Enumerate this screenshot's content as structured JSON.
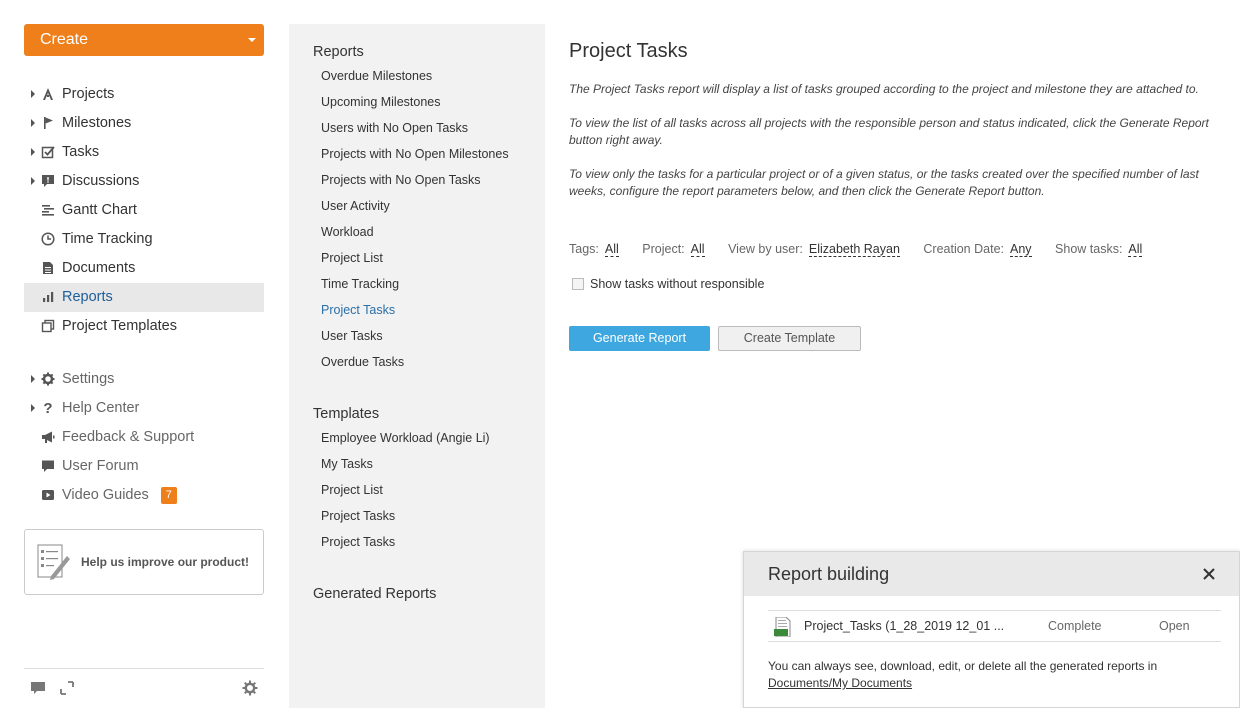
{
  "sidebar": {
    "create_label": "Create",
    "items": [
      {
        "label": "Projects",
        "icon": "projects-icon",
        "expandable": true
      },
      {
        "label": "Milestones",
        "icon": "flag-icon",
        "expandable": true
      },
      {
        "label": "Tasks",
        "icon": "checkbox-icon",
        "expandable": true
      },
      {
        "label": "Discussions",
        "icon": "discussion-icon",
        "expandable": true
      },
      {
        "label": "Gantt Chart",
        "icon": "gantt-icon",
        "expandable": false
      },
      {
        "label": "Time Tracking",
        "icon": "clock-icon",
        "expandable": false
      },
      {
        "label": "Documents",
        "icon": "document-icon",
        "expandable": false
      },
      {
        "label": "Reports",
        "icon": "bar-chart-icon",
        "expandable": false,
        "active": true
      },
      {
        "label": "Project Templates",
        "icon": "templates-icon",
        "expandable": false
      }
    ],
    "secondary_items": [
      {
        "label": "Settings",
        "icon": "gear-icon",
        "expandable": true
      },
      {
        "label": "Help Center",
        "icon": "question-icon",
        "expandable": true
      },
      {
        "label": "Feedback & Support",
        "icon": "megaphone-icon",
        "expandable": false
      },
      {
        "label": "User Forum",
        "icon": "chat-icon",
        "expandable": false
      },
      {
        "label": "Video Guides",
        "icon": "video-icon",
        "expandable": false,
        "badge": "7"
      }
    ],
    "improve_label": "Help us improve our product!"
  },
  "reports_nav": {
    "reports_title": "Reports",
    "reports": [
      "Overdue Milestones",
      "Upcoming Milestones",
      "Users with No Open Tasks",
      "Projects with No Open Milestones",
      "Projects with No Open Tasks",
      "User Activity",
      "Workload",
      "Project List",
      "Time Tracking",
      "Project Tasks",
      "User Tasks",
      "Overdue Tasks"
    ],
    "active_report": "Project Tasks",
    "templates_title": "Templates",
    "templates": [
      "Employee Workload (Angie Li)",
      "My Tasks",
      "Project List",
      "Project Tasks",
      "Project Tasks"
    ],
    "generated_title": "Generated Reports"
  },
  "main": {
    "title": "Project Tasks",
    "desc1": "The Project Tasks report will display a list of tasks grouped according to the project and milestone they are attached to.",
    "desc2": "To view the list of all tasks across all projects with the responsible person and status indicated, click the Generate Report button right away.",
    "desc3": "To view only the tasks for a particular project or of a given status, or the tasks created over the specified number of last weeks, configure the report parameters below, and then click the Generate Report button.",
    "filters": {
      "tags_label": "Tags:",
      "tags_value": "All",
      "project_label": "Project:",
      "project_value": "All",
      "user_label": "View by user:",
      "user_value": "Elizabeth Rayan",
      "date_label": "Creation Date:",
      "date_value": "Any",
      "show_label": "Show tasks:",
      "show_value": "All"
    },
    "checkbox_label": "Show tasks without responsible",
    "generate_label": "Generate Report",
    "template_label": "Create Template"
  },
  "popup": {
    "title": "Report building",
    "file_name": "Project_Tasks (1_28_2019 12_01 ...",
    "status": "Complete",
    "open_label": "Open",
    "note_text": "You can always see, download, edit, or delete all the generated reports in",
    "note_link": "Documents/My Documents"
  },
  "colors": {
    "accent": "#ef7f1a",
    "primary_button": "#3ea7e0",
    "active_link": "#2a6fa8"
  }
}
